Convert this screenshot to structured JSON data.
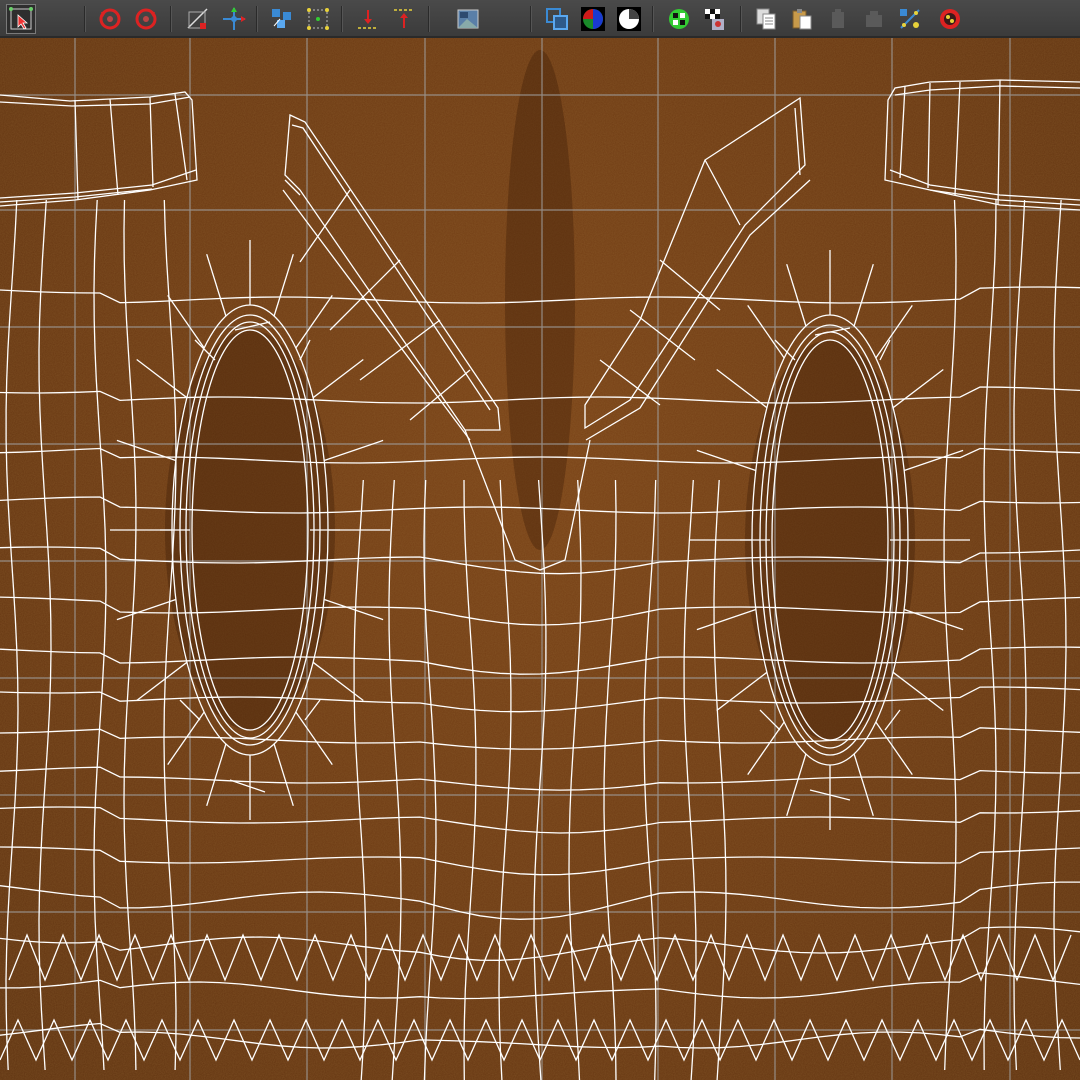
{
  "toolbar": {
    "buttons": [
      {
        "name": "select-faces-tool-button",
        "icon": "select-arrow-icon",
        "active": true
      },
      {
        "name": "rotate-ccw-button",
        "icon": "rotate-ccw-icon"
      },
      {
        "name": "rotate-cw-button",
        "icon": "rotate-cw-icon"
      },
      {
        "name": "grid-snap-button",
        "icon": "grid-snap-icon"
      },
      {
        "name": "move-gizmo-button",
        "icon": "move-gizmo-icon"
      },
      {
        "name": "layout-uvs-button",
        "icon": "layout-uvs-icon"
      },
      {
        "name": "align-uvs-button",
        "icon": "align-uvs-icon"
      },
      {
        "name": "move-down-button",
        "icon": "arrow-down-icon"
      },
      {
        "name": "move-up-button",
        "icon": "arrow-up-icon"
      },
      {
        "name": "texture-image-button",
        "icon": "texture-image-icon"
      },
      {
        "name": "texture-borders-button",
        "icon": "texture-borders-icon"
      },
      {
        "name": "rgb-channels-button",
        "icon": "rgb-channels-icon"
      },
      {
        "name": "shaded-toggle-button",
        "icon": "shaded-toggle-icon"
      },
      {
        "name": "udim-button",
        "icon": "udim-icon"
      },
      {
        "name": "checker-button",
        "icon": "checker-icon"
      },
      {
        "name": "copy-uvs-button",
        "icon": "copy-icon"
      },
      {
        "name": "paste-uvs-button",
        "icon": "paste-icon"
      },
      {
        "name": "disabled-1-button",
        "icon": "disabled-icon"
      },
      {
        "name": "disabled-2-button",
        "icon": "disabled-icon"
      },
      {
        "name": "uv-snapshot-button",
        "icon": "uv-snapshot-icon"
      },
      {
        "name": "uv-settings-button",
        "icon": "uv-settings-icon"
      }
    ]
  },
  "colors": {
    "texture": "#6e3a12",
    "wireframe": "#ffffff",
    "grid": "#9a9a9a",
    "toolbar_bg": "#404040"
  }
}
